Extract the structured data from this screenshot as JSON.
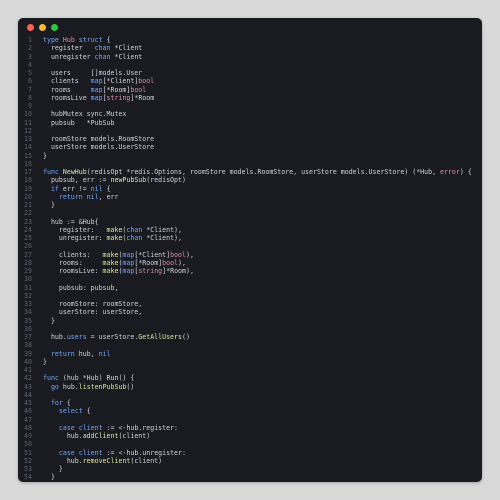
{
  "window": {
    "controls": [
      "close",
      "minimize",
      "maximize"
    ],
    "colors": {
      "close": "#ff5f56",
      "minimize": "#ffbd2e",
      "maximize": "#27c93f"
    }
  },
  "code_lines": [
    [
      [
        "kw",
        "type"
      ],
      [
        "pl",
        " "
      ],
      [
        "ty",
        "Hub"
      ],
      [
        "pl",
        " "
      ],
      [
        "kw",
        "struct"
      ],
      [
        "pl",
        " {"
      ]
    ],
    [
      [
        "pl",
        "  register   "
      ],
      [
        "kw",
        "chan"
      ],
      [
        "pl",
        " *Client"
      ]
    ],
    [
      [
        "pl",
        "  unregister "
      ],
      [
        "kw",
        "chan"
      ],
      [
        "pl",
        " *Client"
      ]
    ],
    [],
    [
      [
        "pl",
        "  users     []models.User"
      ]
    ],
    [
      [
        "pl",
        "  clients   "
      ],
      [
        "kw",
        "map"
      ],
      [
        "pl",
        "[*Client]"
      ],
      [
        "ty",
        "bool"
      ]
    ],
    [
      [
        "pl",
        "  rooms     "
      ],
      [
        "kw",
        "map"
      ],
      [
        "pl",
        "[*Room]"
      ],
      [
        "ty",
        "bool"
      ]
    ],
    [
      [
        "pl",
        "  roomsLive "
      ],
      [
        "kw",
        "map"
      ],
      [
        "pl",
        "["
      ],
      [
        "ty",
        "string"
      ],
      [
        "pl",
        "]*Room"
      ]
    ],
    [],
    [
      [
        "pl",
        "  hubMutex sync.Mutex"
      ]
    ],
    [
      [
        "pl",
        "  pubsub   *PubSub"
      ]
    ],
    [],
    [
      [
        "pl",
        "  roomStore models.RoomStore"
      ]
    ],
    [
      [
        "pl",
        "  userStore models.UserStore"
      ]
    ],
    [
      [
        "pl",
        "}"
      ]
    ],
    [],
    [
      [
        "kw",
        "func"
      ],
      [
        "pl",
        " "
      ],
      [
        "fn",
        "NewHub"
      ],
      [
        "pl",
        "(redisOpt *redis.Options, roomStore models.RoomStore, userStore models.UserStore) (*Hub, "
      ],
      [
        "ty",
        "error"
      ],
      [
        "pl",
        ") {"
      ]
    ],
    [
      [
        "pl",
        "  pubsub, err := "
      ],
      [
        "fn",
        "newPubSub"
      ],
      [
        "pl",
        "(redisOpt)"
      ]
    ],
    [
      [
        "pl",
        "  "
      ],
      [
        "kw",
        "if"
      ],
      [
        "pl",
        " err != "
      ],
      [
        "kw",
        "nil"
      ],
      [
        "pl",
        " {"
      ]
    ],
    [
      [
        "pl",
        "    "
      ],
      [
        "kw",
        "return"
      ],
      [
        "pl",
        " "
      ],
      [
        "kw",
        "nil"
      ],
      [
        "pl",
        ", err"
      ]
    ],
    [
      [
        "pl",
        "  }"
      ]
    ],
    [],
    [
      [
        "pl",
        "  hub := &Hub{"
      ]
    ],
    [
      [
        "pl",
        "    register:   "
      ],
      [
        "fn",
        "make"
      ],
      [
        "pl",
        "("
      ],
      [
        "kw",
        "chan"
      ],
      [
        "pl",
        " *Client),"
      ]
    ],
    [
      [
        "pl",
        "    unregister: "
      ],
      [
        "fn",
        "make"
      ],
      [
        "pl",
        "("
      ],
      [
        "kw",
        "chan"
      ],
      [
        "pl",
        " *Client),"
      ]
    ],
    [],
    [
      [
        "pl",
        "    clients:   "
      ],
      [
        "fn",
        "make"
      ],
      [
        "pl",
        "("
      ],
      [
        "kw",
        "map"
      ],
      [
        "pl",
        "[*Client]"
      ],
      [
        "ty",
        "bool"
      ],
      [
        "pl",
        "),"
      ]
    ],
    [
      [
        "pl",
        "    rooms:     "
      ],
      [
        "fn",
        "make"
      ],
      [
        "pl",
        "("
      ],
      [
        "kw",
        "map"
      ],
      [
        "pl",
        "[*Room]"
      ],
      [
        "ty",
        "bool"
      ],
      [
        "pl",
        "),"
      ]
    ],
    [
      [
        "pl",
        "    roomsLive: "
      ],
      [
        "fn",
        "make"
      ],
      [
        "pl",
        "("
      ],
      [
        "kw",
        "map"
      ],
      [
        "pl",
        "["
      ],
      [
        "ty",
        "string"
      ],
      [
        "pl",
        "]*Room),"
      ]
    ],
    [],
    [
      [
        "pl",
        "    pubsub: pubsub,"
      ]
    ],
    [],
    [
      [
        "pl",
        "    roomStore: roomStore,"
      ]
    ],
    [
      [
        "pl",
        "    userStore: userStore,"
      ]
    ],
    [
      [
        "pl",
        "  }"
      ]
    ],
    [],
    [
      [
        "pl",
        "  hub."
      ],
      [
        "kw",
        "users"
      ],
      [
        "pl",
        " = userStore."
      ],
      [
        "fn",
        "GetAllUsers"
      ],
      [
        "pl",
        "()"
      ]
    ],
    [],
    [
      [
        "pl",
        "  "
      ],
      [
        "kw",
        "return"
      ],
      [
        "pl",
        " hub, "
      ],
      [
        "kw",
        "nil"
      ]
    ],
    [
      [
        "pl",
        "}"
      ]
    ],
    [],
    [
      [
        "kw",
        "func"
      ],
      [
        "pl",
        " (hub *Hub) "
      ],
      [
        "fn",
        "Run"
      ],
      [
        "pl",
        "() {"
      ]
    ],
    [
      [
        "pl",
        "  "
      ],
      [
        "kw",
        "go"
      ],
      [
        "pl",
        " hub."
      ],
      [
        "fn",
        "listenPubSub"
      ],
      [
        "pl",
        "()"
      ]
    ],
    [],
    [
      [
        "pl",
        "  "
      ],
      [
        "kw",
        "for"
      ],
      [
        "pl",
        " {"
      ]
    ],
    [
      [
        "pl",
        "    "
      ],
      [
        "kw",
        "select"
      ],
      [
        "pl",
        " {"
      ]
    ],
    [],
    [
      [
        "pl",
        "    "
      ],
      [
        "kw",
        "case"
      ],
      [
        "pl",
        " "
      ],
      [
        "kw",
        "client"
      ],
      [
        "pl",
        " := <-hub.register:"
      ]
    ],
    [
      [
        "pl",
        "      hub."
      ],
      [
        "fn",
        "addClient"
      ],
      [
        "pl",
        "(client)"
      ]
    ],
    [],
    [
      [
        "pl",
        "    "
      ],
      [
        "kw",
        "case"
      ],
      [
        "pl",
        " "
      ],
      [
        "kw",
        "client"
      ],
      [
        "pl",
        " := <-hub.unregister:"
      ]
    ],
    [
      [
        "pl",
        "      hub."
      ],
      [
        "fn",
        "removeClient"
      ],
      [
        "pl",
        "(client)"
      ]
    ],
    [
      [
        "pl",
        "    }"
      ]
    ],
    [
      [
        "pl",
        "  }"
      ]
    ],
    [
      [
        "pl",
        "}"
      ]
    ]
  ]
}
